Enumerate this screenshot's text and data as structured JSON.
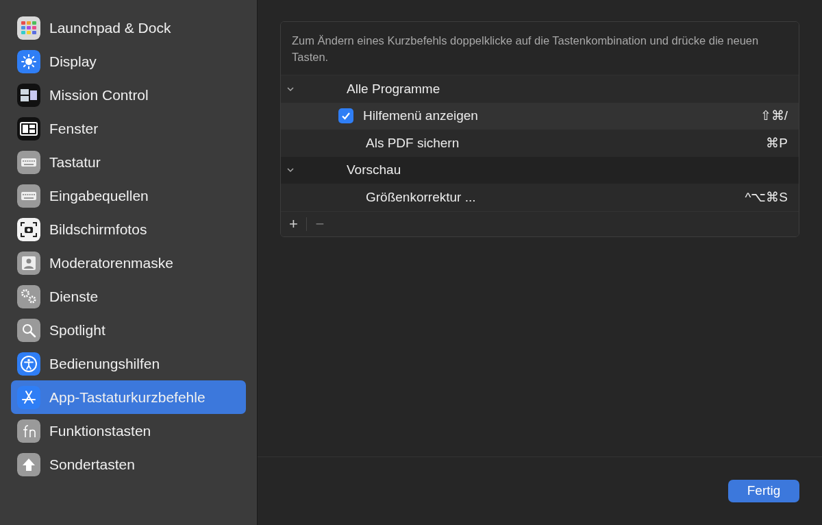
{
  "sidebar": {
    "items": [
      {
        "label": "Launchpad & Dock",
        "selected": false
      },
      {
        "label": "Display",
        "selected": false
      },
      {
        "label": "Mission Control",
        "selected": false
      },
      {
        "label": "Fenster",
        "selected": false
      },
      {
        "label": "Tastatur",
        "selected": false
      },
      {
        "label": "Eingabequellen",
        "selected": false
      },
      {
        "label": "Bildschirmfotos",
        "selected": false
      },
      {
        "label": "Moderatorenmaske",
        "selected": false
      },
      {
        "label": "Dienste",
        "selected": false
      },
      {
        "label": "Spotlight",
        "selected": false
      },
      {
        "label": "Bedienungshilfen",
        "selected": false
      },
      {
        "label": "App-Tastaturkurzbefehle",
        "selected": true
      },
      {
        "label": "Funktionstasten",
        "selected": false
      },
      {
        "label": "Sondertasten",
        "selected": false
      }
    ]
  },
  "shortcuts": {
    "description": "Zum Ändern eines Kurzbefehls doppelklicke auf die Tastenkombination und drücke die neuen Tasten.",
    "groups": [
      {
        "label": "Alle Programme",
        "expanded": true,
        "children": [
          {
            "label": "Hilfemenü anzeigen",
            "keys": "⇧⌘/",
            "selected": true,
            "checkbox": {
              "checked": true
            }
          },
          {
            "label": "Als PDF sichern",
            "keys": "⌘P",
            "selected": false
          }
        ]
      },
      {
        "label": "Vorschau",
        "expanded": true,
        "children": [
          {
            "label": "Größenkorrektur ...",
            "keys": "^⌥⌘S",
            "selected": false
          }
        ]
      }
    ],
    "add_button": "+",
    "remove_button": "−"
  },
  "done_button": "Fertig"
}
